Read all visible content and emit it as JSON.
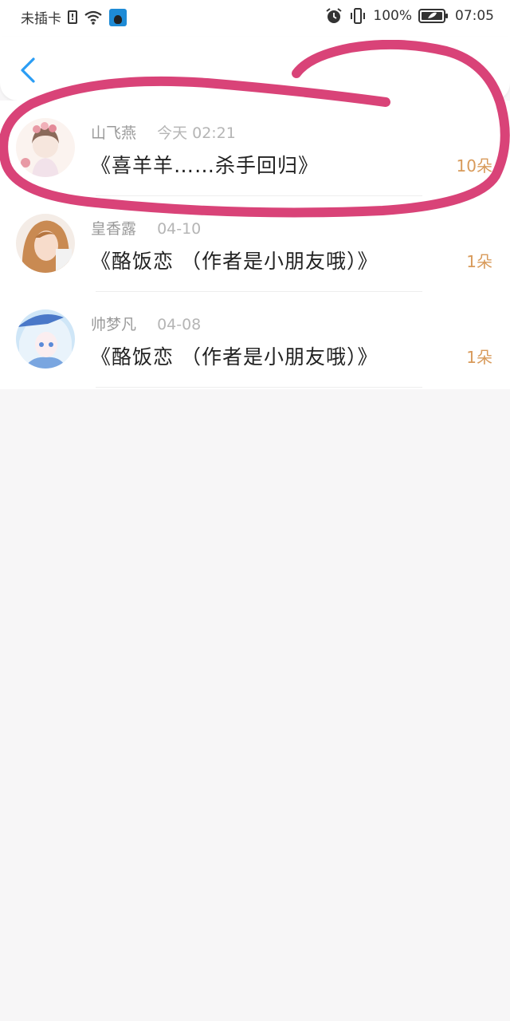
{
  "status_bar": {
    "carrier": "未插卡",
    "sim_alert": "!",
    "battery_percent": "100%",
    "time": "07:05",
    "icons": [
      "sim-alert-icon",
      "wifi-icon",
      "qq-icon",
      "alarm-icon",
      "vibrate-icon",
      "battery-icon"
    ]
  },
  "header": {
    "back_icon": "chevron-left-icon",
    "accent_color": "#2a9df4"
  },
  "list": {
    "items": [
      {
        "name": "山飞燕",
        "date": "今天 02:21",
        "title": "《喜羊羊……杀手回归》",
        "count": "10朵",
        "avatar": "avatar-girl-flowers"
      },
      {
        "name": "皇香露",
        "date": "04-10",
        "title": "《酪饭恋 （作者是小朋友哦）》",
        "count": "1朵",
        "avatar": "avatar-photo-girl"
      },
      {
        "name": "帅梦凡",
        "date": "04-08",
        "title": "《酪饭恋 （作者是小朋友哦）》",
        "count": "1朵",
        "avatar": "avatar-anime-blue"
      }
    ],
    "count_color": "#d89a5a"
  },
  "annotation": {
    "color": "#d6336c"
  }
}
